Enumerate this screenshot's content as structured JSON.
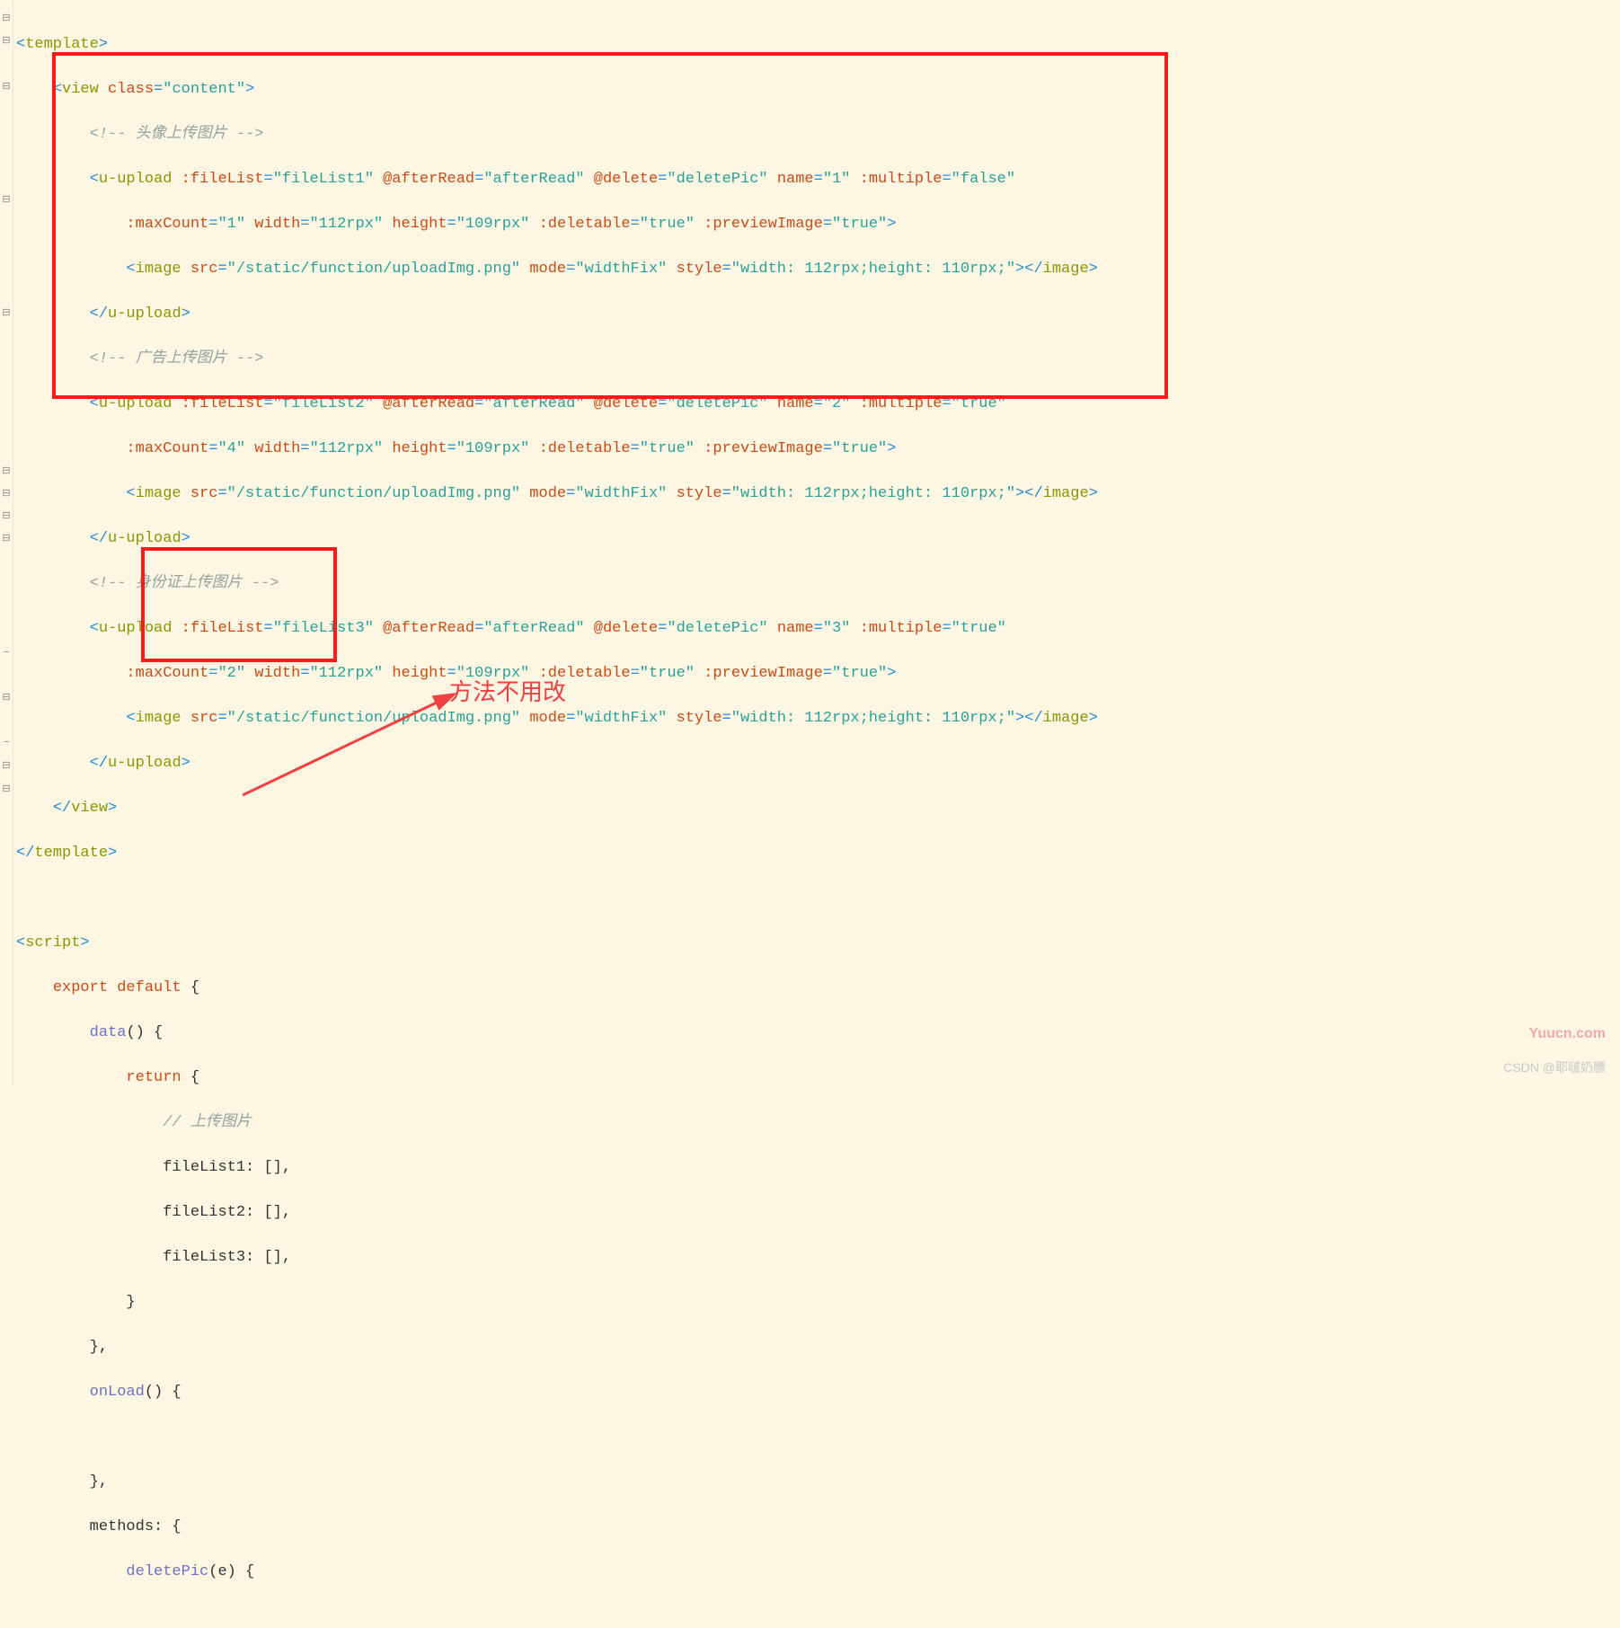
{
  "code": {
    "l1": "<template>",
    "l2_view": "view",
    "l2_class": "class",
    "l2_val": "\"content\"",
    "c1": "<!-- 头像上传图片 -->",
    "up": "u-upload",
    "fl": ":fileList",
    "ar": "@afterRead",
    "arv": "\"afterRead\"",
    "del": "@delete",
    "delv": "\"deletePic\"",
    "nm": "name",
    "mul": ":multiple",
    "tf": "\"false\"",
    "tt": "\"true\"",
    "fl1": "\"fileList1\"",
    "fl2": "\"fileList2\"",
    "fl3": "\"fileList3\"",
    "n1": "\"1\"",
    "n2": "\"2\"",
    "n3": "\"3\"",
    "mc": ":maxCount",
    "mc1": "\"1\"",
    "mc4": "\"4\"",
    "mc2": "\"2\"",
    "w": "width",
    "wv": "\"112rpx\"",
    "h": "height",
    "hv": "\"109rpx\"",
    "dt": ":deletable",
    "pi": ":previewImage",
    "img": "image",
    "src": "src",
    "srcv": "\"/static/function/uploadImg.png\"",
    "mode": "mode",
    "modev": "\"widthFix\"",
    "style": "style",
    "stylev": "\"width: 112rpx;height: 110rpx;\"",
    "cimg": "</image>",
    "cup": "</u-upload>",
    "c2": "<!-- 广告上传图片 -->",
    "c3": "<!-- 身份证上传图片 -->",
    "cview": "</view>",
    "ctmpl": "</template>",
    "script": "<script>",
    "export": "export",
    "default": "default",
    "data": "data",
    "return": "return",
    "cmt": "// 上传图片",
    "f1": "fileList1: [],",
    "f2": "fileList2: [],",
    "f3": "fileList3: [],",
    "onload": "onLoad",
    "methods": "methods",
    "dpic": "deletePic",
    "e": "e"
  },
  "annotation": "方法不用改",
  "watermark_csdn": "CSDN @耶啵奶膘",
  "watermark_yuucn": "Yuucn.com"
}
